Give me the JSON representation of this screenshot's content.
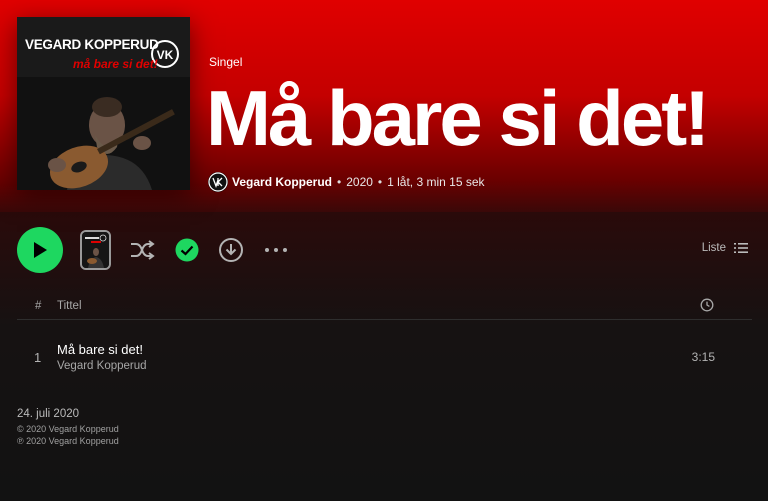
{
  "album": {
    "cover": {
      "artist_text": "VEGARD KOPPERUD",
      "title_text": "må bare si det!",
      "logo_text": "VK"
    },
    "type_label": "Singel",
    "title": "Må bare si det!",
    "artist": "Vegard Kopperud",
    "year": "2020",
    "summary": "1 låt, 3 min 15 sek"
  },
  "controls": {
    "play_icon": "play-icon",
    "shuffle_icon": "shuffle-icon",
    "saved_icon": "check-circle-icon",
    "download_icon": "download-icon",
    "more_icon": "more-horizontal-icon",
    "view_label": "Liste",
    "accent_color": "#1ed760"
  },
  "tracklist": {
    "headers": {
      "number": "#",
      "title": "Tittel",
      "duration_icon": "clock-icon"
    },
    "tracks": [
      {
        "number": "1",
        "title": "Må bare si det!",
        "artist": "Vegard Kopperud",
        "duration": "3:15"
      }
    ]
  },
  "footer": {
    "release_date": "24. juli 2020",
    "copyright": "© 2020 Vegard Kopperud",
    "phonogram": "℗ 2020 Vegard Kopperud"
  },
  "colors": {
    "hero": "#e00000",
    "background": "#121212"
  }
}
